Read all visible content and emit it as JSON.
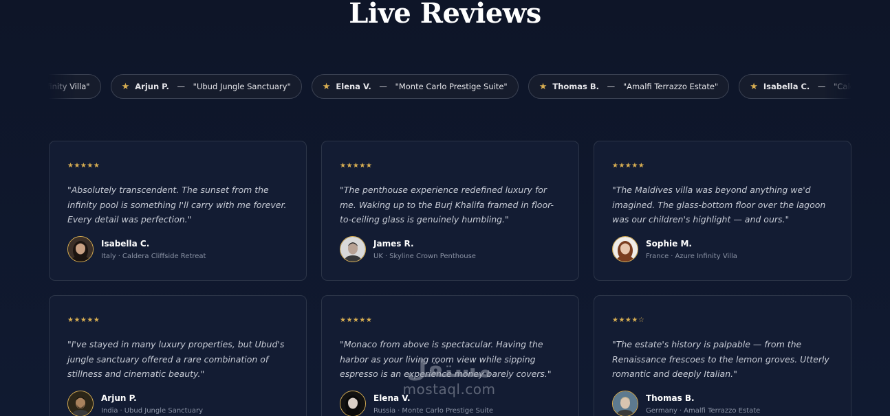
{
  "section": {
    "title": "Live Reviews"
  },
  "ticker": [
    {
      "name": "",
      "property": "\"Azure Infinity Villa\""
    },
    {
      "name": "Arjun P.",
      "property": "\"Ubud Jungle Sanctuary\""
    },
    {
      "name": "Elena V.",
      "property": "\"Monte Carlo Prestige Suite\""
    },
    {
      "name": "Thomas B.",
      "property": "\"Amalfi Terrazzo Estate\""
    },
    {
      "name": "Isabella C.",
      "property": "\"Caldera Cliffside Retreat\""
    }
  ],
  "ticker_separator": " — ",
  "meta_separator": "·",
  "reviews": [
    {
      "stars": "★★★★★",
      "quote": "\"Absolutely transcendent. The sunset from the infinity pool is something I'll carry with me forever. Every detail was perfection.\"",
      "name": "Isabella C.",
      "country": "Italy",
      "property": "Caldera Cliffside Retreat",
      "avatar": "woman-dark-hair"
    },
    {
      "stars": "★★★★★",
      "quote": "\"The penthouse experience redefined luxury for me. Waking up to the Burj Khalifa framed in floor-to-ceiling glass is genuinely humbling.\"",
      "name": "James R.",
      "country": "UK",
      "property": "Skyline Crown Penthouse",
      "avatar": "man-curly-hair"
    },
    {
      "stars": "★★★★★",
      "quote": "\"The Maldives villa was beyond anything we'd imagined. The glass-bottom floor over the lagoon was our children's highlight — and ours.\"",
      "name": "Sophie M.",
      "country": "France",
      "property": "Azure Infinity Villa",
      "avatar": "woman-auburn-hair"
    },
    {
      "stars": "★★★★★",
      "quote": "\"I've stayed in many luxury properties, but Ubud's jungle sanctuary offered a rare combination of stillness and cinematic beauty.\"",
      "name": "Arjun P.",
      "country": "India",
      "property": "Ubud Jungle Sanctuary",
      "avatar": "man-beard"
    },
    {
      "stars": "★★★★★",
      "quote": "\"Monaco from above is spectacular. Having the harbor as your living room view while sipping espresso is an experience money barely covers.\"",
      "name": "Elena V.",
      "country": "Russia",
      "property": "Monte Carlo Prestige Suite",
      "avatar": "woman-dark-portrait"
    },
    {
      "stars": "★★★★☆",
      "quote": "\"The estate's history is palpable — from the Renaissance frescoes to the lemon groves. Utterly romantic and deeply Italian.\"",
      "name": "Thomas B.",
      "country": "Germany",
      "property": "Amalfi Terrazzo Estate",
      "avatar": "man-blond"
    }
  ],
  "watermark": {
    "arabic": "مستقل",
    "latin": "mostaql.com"
  },
  "colors": {
    "background": "#0f1629",
    "card": "#131c33",
    "gold": "#d8ae52",
    "border": "#2c3548"
  }
}
